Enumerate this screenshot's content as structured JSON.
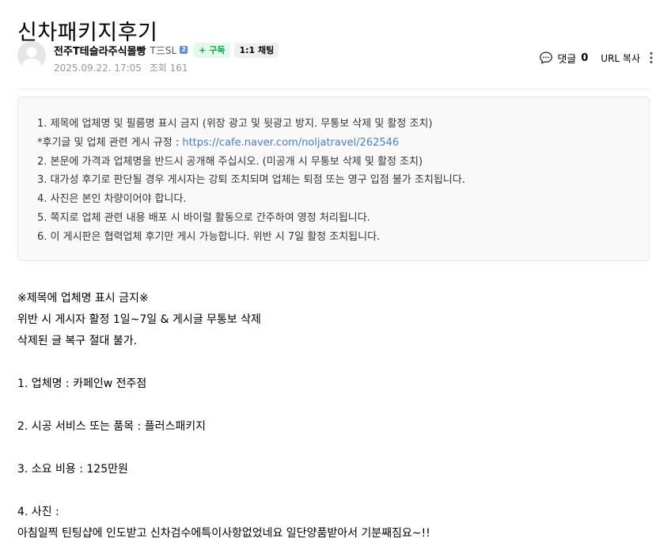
{
  "post": {
    "title": "신차패키지후기",
    "author": {
      "name": "전주T테슬라주식몰빵",
      "level": "T三SL",
      "level_badge": "2",
      "subscribe_label": "+ 구독",
      "chat_label": "1:1 채팅"
    },
    "date": "2025.09.22. 17:05",
    "views": "조회 161",
    "actions": {
      "comment_label": "댓글",
      "comment_count": "0",
      "url_copy_label": "URL 복사"
    }
  },
  "notice": {
    "lines": [
      "1. 제목에 업체명 및 필름명 표시 금지 (위장 광고 및 뒷광고 방지. 무통보 삭제 및 활정 조치)",
      "*후기글 및 업체 관련 게시 규정 : ",
      "2. 본문에 가격과 업체명을 반드시 공개해 주십시오. (미공개 시 무통보 삭제 및 활정 조치)",
      "3. 대가성 후기로 판단될 경우 게시자는 강퇴 조치되며 업체는 퇴점 또는 영구 입점 불가 조치됩니다.",
      "4. 사진은 본인 차량이어야 합니다.",
      "5. 쪽지로 업체 관련 내용 배포 시 바이럴 활동으로 간주하여 영정 처리됩니다.",
      "6. 이 게시판은 협력업체 후기만 게시 가능합니다. 위반 시 7일 활정 조치됩니다."
    ],
    "link_text": "https://cafe.naver.com/noljatravel/262546"
  },
  "content": {
    "lines": [
      "※제목에 업체명 표시 금지※",
      "위반 시 게시자 활정 1일~7일 & 게시글 무통보 삭제",
      "삭제된 글 복구 절대 불가.",
      "",
      "1. 업체명 :  카페인w 전주점",
      "",
      "2. 시공 서비스 또는 품목 :  플러스패키지",
      "",
      "3. 소요 비용 :  125만원",
      "",
      "4. 사진 :",
      "아침일찍 틴팅샵에 인도받고 신차검수에특이사항없었네요  일단양품받아서 기분째짐요~!!"
    ]
  },
  "colors": {
    "subscribe_text": "#03a94d",
    "subscribe_bg": "#e6f8ec",
    "link": "#4b7ec6",
    "meta": "#979797",
    "notice_bg": "#f9f9fa"
  },
  "icons": [
    "default-avatar-icon",
    "level-badge-icon",
    "comment-bubble-icon",
    "more-vertical-icon"
  ]
}
